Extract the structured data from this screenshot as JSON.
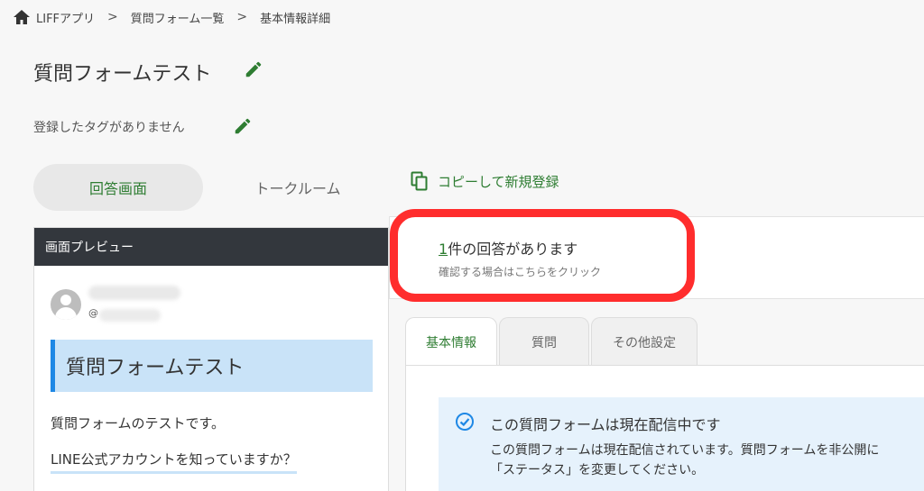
{
  "breadcrumb": {
    "items": [
      "LIFFアプリ",
      "質問フォーム一覧",
      "基本情報詳細"
    ],
    "separator": ">"
  },
  "page": {
    "title": "質問フォームテスト",
    "tags_text": "登録したタグがありません"
  },
  "view_toggle": {
    "answer_label": "回答画面",
    "talk_label": "トークルーム"
  },
  "copy_link": {
    "label": "コピーして新規登録"
  },
  "preview": {
    "header": "画面プレビュー",
    "account_id_prefix": "@",
    "form_title": "質問フォームテスト",
    "description": "質問フォームのテストです。",
    "question": "LINE公式アカウントを知っていますか？"
  },
  "answers": {
    "count": "1",
    "count_suffix": "件の回答があります",
    "hint": "確認する場合はこちらをクリック"
  },
  "tabs": [
    {
      "label": "基本情報",
      "active": true
    },
    {
      "label": "質問",
      "active": false
    },
    {
      "label": "その他設定",
      "active": false
    }
  ],
  "status": {
    "title": "この質問フォームは現在配信中です",
    "line1": "この質問フォームは現在配信されています。質問フォームを非公開に",
    "line2": "「ステータス」を変更してください。"
  },
  "colors": {
    "accent_green": "#2e7d32",
    "highlight_red": "#ff2d2d",
    "preview_header": "#33373d",
    "info_blue": "#e6f2fc"
  },
  "icons": [
    "home-icon",
    "chevron-right-icon",
    "pencil-icon",
    "copy-icon",
    "check-circle-icon",
    "avatar-icon"
  ]
}
